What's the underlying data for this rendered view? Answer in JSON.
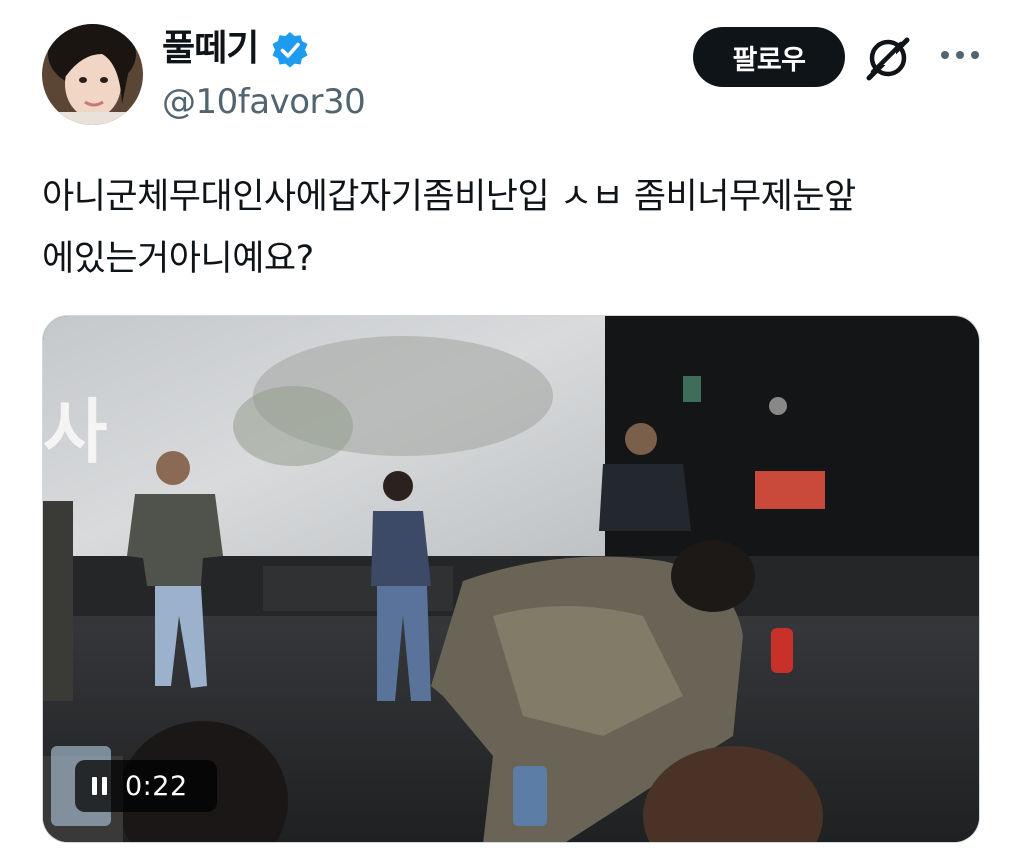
{
  "author": {
    "display_name": "풀떼기",
    "handle": "@10favor30",
    "verified": true
  },
  "actions": {
    "follow_label": "팔로우",
    "grok_icon": "grok-icon",
    "more_icon": "more-icon"
  },
  "tweet": {
    "text": "아니군체무대인사에갑자기좀비난입 ㅅㅂ 좀비너무제눈앞\n에있는거아니예요?"
  },
  "media": {
    "type": "video",
    "duration": "0:22",
    "control_icon": "pause-icon"
  },
  "colors": {
    "accent": "#1d9bf0",
    "text": "#0f1419",
    "secondary": "#536471"
  }
}
